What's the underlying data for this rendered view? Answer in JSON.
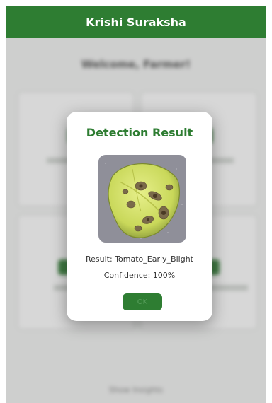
{
  "app": {
    "title": "Krishi Suraksha"
  },
  "background": {
    "welcome_text": "Welcome, Farmer!",
    "footer_text": "Show Insights"
  },
  "dialog": {
    "title": "Detection Result",
    "result_label": "Result:",
    "result_value": "Tomato_Early_Blight",
    "confidence_label": "Confidence:",
    "confidence_value": "100%",
    "ok_label": "OK"
  },
  "colors": {
    "primary": "#2e7d32",
    "dialog_bg": "#ffffff"
  },
  "icons": {
    "leaf_photo": "diseased-tomato-leaf"
  }
}
